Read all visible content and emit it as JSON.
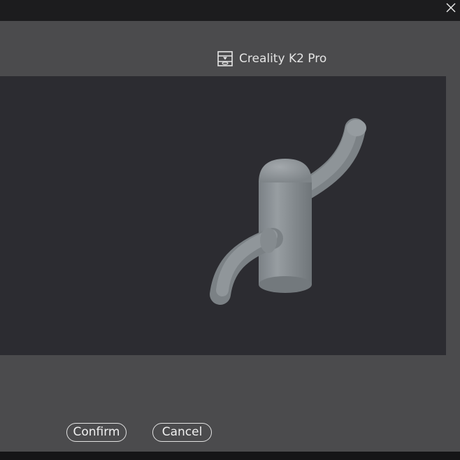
{
  "window": {
    "close_icon": "close-icon"
  },
  "printer": {
    "icon": "printer-icon",
    "name": "Creality K2 Pro"
  },
  "preview": {
    "object": "3d-hook-model",
    "background_color": "#2c2c31",
    "model_color": "#8e9498"
  },
  "actions": {
    "confirm_label": "Confirm",
    "cancel_label": "Cancel"
  },
  "colors": {
    "dialog_bg": "#4b4b4d",
    "titlebar_bg": "#1c1c1e",
    "text": "#e4e4e4"
  }
}
